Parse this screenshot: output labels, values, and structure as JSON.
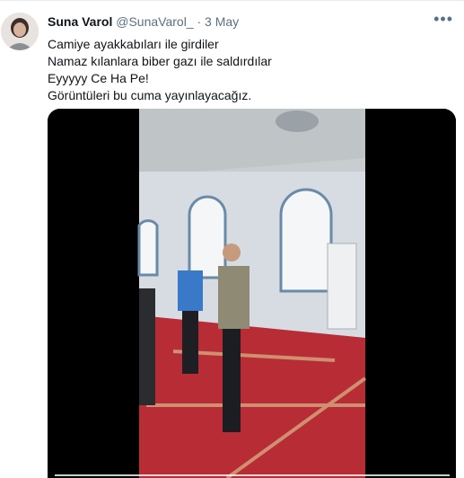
{
  "tweet": {
    "author_name": "Suna Varol",
    "handle": "@SunaVarol_",
    "separator": "·",
    "date": "3 May",
    "more_icon": "more-horizontal-icon",
    "lines": [
      "Camiye ayakkabıları ile girdiler",
      "Namaz kılanlara biber gazı ile saldırdılar",
      "Eyyyyy Ce Ha Pe!",
      "Görüntüleri bu cuma yayınlayacağız."
    ]
  },
  "colors": {
    "name": "#0f1419",
    "secondary": "#5b7083",
    "video_bg": "#000000",
    "carpet": "#b82d35",
    "wall": "#d8dde3"
  }
}
